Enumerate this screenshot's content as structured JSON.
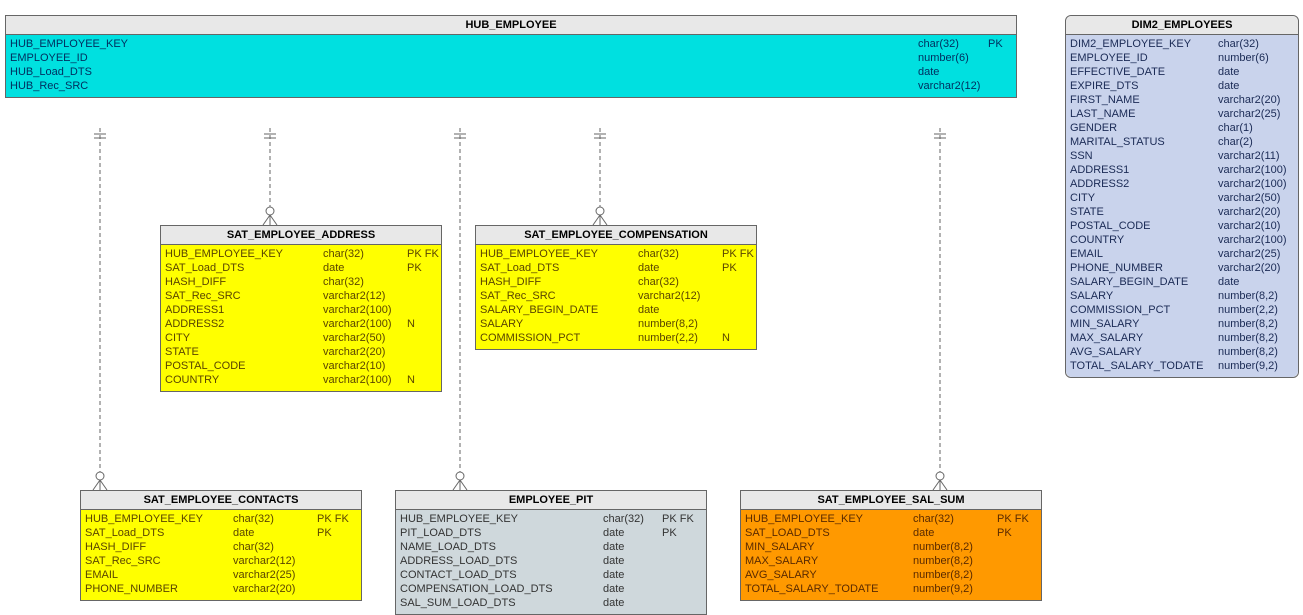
{
  "hub": {
    "title": "HUB_EMPLOYEE",
    "cols": [
      {
        "name": "HUB_EMPLOYEE_KEY",
        "type": "char(32)",
        "flag": "PK"
      },
      {
        "name": "EMPLOYEE_ID",
        "type": "number(6)",
        "flag": ""
      },
      {
        "name": "HUB_Load_DTS",
        "type": "date",
        "flag": ""
      },
      {
        "name": "HUB_Rec_SRC",
        "type": "varchar2(12)",
        "flag": ""
      }
    ]
  },
  "sat_address": {
    "title": "SAT_EMPLOYEE_ADDRESS",
    "cols": [
      {
        "name": "HUB_EMPLOYEE_KEY",
        "type": "char(32)",
        "flag": "PK FK"
      },
      {
        "name": "SAT_Load_DTS",
        "type": "date",
        "flag": "PK"
      },
      {
        "name": "HASH_DIFF",
        "type": "char(32)",
        "flag": ""
      },
      {
        "name": "SAT_Rec_SRC",
        "type": "varchar2(12)",
        "flag": ""
      },
      {
        "name": "ADDRESS1",
        "type": "varchar2(100)",
        "flag": ""
      },
      {
        "name": "ADDRESS2",
        "type": "varchar2(100)",
        "flag": "N"
      },
      {
        "name": "CITY",
        "type": "varchar2(50)",
        "flag": ""
      },
      {
        "name": "STATE",
        "type": "varchar2(20)",
        "flag": ""
      },
      {
        "name": "POSTAL_CODE",
        "type": "varchar2(10)",
        "flag": ""
      },
      {
        "name": "COUNTRY",
        "type": "varchar2(100)",
        "flag": "N"
      }
    ]
  },
  "sat_comp": {
    "title": "SAT_EMPLOYEE_COMPENSATION",
    "cols": [
      {
        "name": "HUB_EMPLOYEE_KEY",
        "type": "char(32)",
        "flag": "PK FK"
      },
      {
        "name": "SAT_Load_DTS",
        "type": "date",
        "flag": "PK"
      },
      {
        "name": "HASH_DIFF",
        "type": "char(32)",
        "flag": ""
      },
      {
        "name": "SAT_Rec_SRC",
        "type": "varchar2(12)",
        "flag": ""
      },
      {
        "name": "SALARY_BEGIN_DATE",
        "type": "date",
        "flag": ""
      },
      {
        "name": "SALARY",
        "type": "number(8,2)",
        "flag": ""
      },
      {
        "name": "COMMISSION_PCT",
        "type": "number(2,2)",
        "flag": "N"
      }
    ]
  },
  "sat_contacts": {
    "title": "SAT_EMPLOYEE_CONTACTS",
    "cols": [
      {
        "name": "HUB_EMPLOYEE_KEY",
        "type": "char(32)",
        "flag": "PK FK"
      },
      {
        "name": "SAT_Load_DTS",
        "type": "date",
        "flag": "PK"
      },
      {
        "name": "HASH_DIFF",
        "type": "char(32)",
        "flag": ""
      },
      {
        "name": "SAT_Rec_SRC",
        "type": "varchar2(12)",
        "flag": ""
      },
      {
        "name": "EMAIL",
        "type": "varchar2(25)",
        "flag": ""
      },
      {
        "name": "PHONE_NUMBER",
        "type": "varchar2(20)",
        "flag": ""
      }
    ]
  },
  "pit": {
    "title": "EMPLOYEE_PIT",
    "cols": [
      {
        "name": "HUB_EMPLOYEE_KEY",
        "type": "char(32)",
        "flag": "PK FK"
      },
      {
        "name": "PIT_LOAD_DTS",
        "type": "date",
        "flag": "PK"
      },
      {
        "name": "NAME_LOAD_DTS",
        "type": "date",
        "flag": ""
      },
      {
        "name": "ADDRESS_LOAD_DTS",
        "type": "date",
        "flag": ""
      },
      {
        "name": "CONTACT_LOAD_DTS",
        "type": "date",
        "flag": ""
      },
      {
        "name": "COMPENSATION_LOAD_DTS",
        "type": "date",
        "flag": ""
      },
      {
        "name": "SAL_SUM_LOAD_DTS",
        "type": "date",
        "flag": ""
      }
    ]
  },
  "sat_salsum": {
    "title": "SAT_EMPLOYEE_SAL_SUM",
    "cols": [
      {
        "name": "HUB_EMPLOYEE_KEY",
        "type": "char(32)",
        "flag": "PK FK"
      },
      {
        "name": "SAT_LOAD_DTS",
        "type": "date",
        "flag": "PK"
      },
      {
        "name": "MIN_SALARY",
        "type": "number(8,2)",
        "flag": ""
      },
      {
        "name": "MAX_SALARY",
        "type": "number(8,2)",
        "flag": ""
      },
      {
        "name": "AVG_SALARY",
        "type": "number(8,2)",
        "flag": ""
      },
      {
        "name": "TOTAL_SALARY_TODATE",
        "type": "number(9,2)",
        "flag": ""
      }
    ]
  },
  "dim2": {
    "title": "DIM2_EMPLOYEES",
    "cols": [
      {
        "name": "DIM2_EMPLOYEE_KEY",
        "type": "char(32)",
        "flag": ""
      },
      {
        "name": "EMPLOYEE_ID",
        "type": "number(6)",
        "flag": ""
      },
      {
        "name": "EFFECTIVE_DATE",
        "type": "date",
        "flag": ""
      },
      {
        "name": "EXPIRE_DTS",
        "type": "date",
        "flag": ""
      },
      {
        "name": "FIRST_NAME",
        "type": "varchar2(20)",
        "flag": ""
      },
      {
        "name": "LAST_NAME",
        "type": "varchar2(25)",
        "flag": ""
      },
      {
        "name": "GENDER",
        "type": "char(1)",
        "flag": ""
      },
      {
        "name": "MARITAL_STATUS",
        "type": "char(2)",
        "flag": ""
      },
      {
        "name": "SSN",
        "type": "varchar2(11)",
        "flag": ""
      },
      {
        "name": "ADDRESS1",
        "type": "varchar2(100)",
        "flag": ""
      },
      {
        "name": "ADDRESS2",
        "type": "varchar2(100)",
        "flag": ""
      },
      {
        "name": "CITY",
        "type": "varchar2(50)",
        "flag": ""
      },
      {
        "name": "STATE",
        "type": "varchar2(20)",
        "flag": ""
      },
      {
        "name": "POSTAL_CODE",
        "type": "varchar2(10)",
        "flag": ""
      },
      {
        "name": "COUNTRY",
        "type": "varchar2(100)",
        "flag": ""
      },
      {
        "name": "EMAIL",
        "type": "varchar2(25)",
        "flag": ""
      },
      {
        "name": "PHONE_NUMBER",
        "type": "varchar2(20)",
        "flag": ""
      },
      {
        "name": "SALARY_BEGIN_DATE",
        "type": "date",
        "flag": ""
      },
      {
        "name": "SALARY",
        "type": "number(8,2)",
        "flag": ""
      },
      {
        "name": "COMMISSION_PCT",
        "type": "number(2,2)",
        "flag": ""
      },
      {
        "name": "MIN_SALARY",
        "type": "number(8,2)",
        "flag": ""
      },
      {
        "name": "MAX_SALARY",
        "type": "number(8,2)",
        "flag": ""
      },
      {
        "name": "AVG_SALARY",
        "type": "number(8,2)",
        "flag": ""
      },
      {
        "name": "TOTAL_SALARY_TODATE",
        "type": "number(9,2)",
        "flag": ""
      }
    ]
  }
}
